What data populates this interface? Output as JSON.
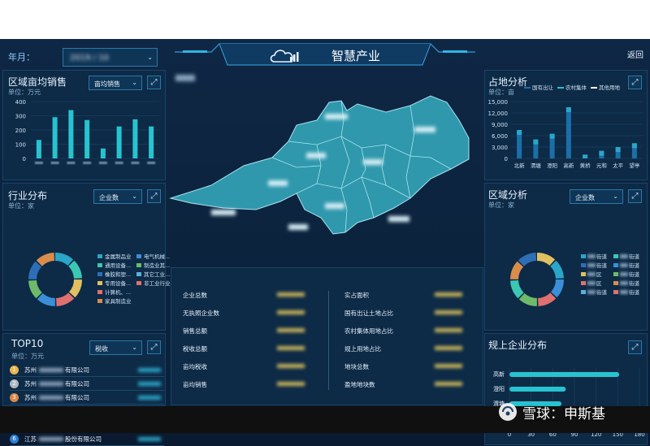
{
  "header": {
    "year_label": "年月：",
    "date_value": "2019 / 10",
    "title": "智慧产业",
    "back_label": "返回"
  },
  "sales": {
    "title": "区域亩均销售",
    "unit": "单位：万元",
    "select": "亩均销售",
    "chart_data": {
      "type": "bar",
      "yticks": [
        "400",
        "300",
        "200",
        "100",
        "0"
      ],
      "ylim": [
        0,
        400
      ],
      "values": [
        130,
        290,
        340,
        270,
        70,
        225,
        275,
        225
      ]
    }
  },
  "industry": {
    "title": "行业分布",
    "unit": "单位：家",
    "select": "企业数",
    "legend": [
      "金属制品业",
      "通用设备...",
      "橡胶和塑...",
      "专用设备...",
      "计算机、...",
      "家具制造业",
      "电气机械...",
      "制造业其...",
      "其它工业...",
      "非工业行业"
    ]
  },
  "top10": {
    "title": "TOP10",
    "unit": "单位：万元",
    "select": "税收",
    "rows": [
      {
        "rank": "1",
        "name": "苏州",
        "suffix": "有限公司"
      },
      {
        "rank": "2",
        "name": "苏州",
        "suffix": "有限公司"
      },
      {
        "rank": "3",
        "name": "苏州",
        "suffix": "有限公司"
      },
      {
        "rank": "4",
        "name": "苏州",
        "suffix": "科技有限公司"
      },
      {
        "rank": "5",
        "name": "苏州",
        "suffix": "科技股份有限公司"
      },
      {
        "rank": "6",
        "name": "江苏",
        "suffix": "股份有限公司"
      }
    ]
  },
  "stats": {
    "left": [
      "企业总数",
      "无执照企业数",
      "销售总额",
      "税收总额",
      "亩均税收",
      "亩均销售"
    ],
    "right": [
      "实占面积",
      "国有出让土地占比",
      "农村集体用地占比",
      "规上用地占比",
      "地块总数",
      "盈地地块数"
    ]
  },
  "land": {
    "title": "占地分析",
    "unit": "单位：亩",
    "legend": [
      "国有出让",
      "农村集体",
      "其他用地"
    ],
    "chart_data": {
      "type": "bar",
      "categories": [
        "北新",
        "渭塘",
        "澄阳",
        "高新",
        "黄桥",
        "元和",
        "太平",
        "望亭"
      ],
      "yticks": [
        "15,000",
        "12,000",
        "9,000",
        "6,000",
        "3,000",
        "0"
      ],
      "ylim": [
        0,
        15000
      ],
      "series": [
        {
          "name": "国有出让",
          "values": [
            7500,
            5000,
            6500,
            13500,
            1000,
            2000,
            3000,
            4000
          ]
        }
      ]
    }
  },
  "region": {
    "title": "区域分析",
    "unit": "单位：家",
    "select": "企业数",
    "legend": [
      "街道",
      "街道",
      "街道",
      "街道",
      "区",
      "街道",
      "区",
      "街道",
      "街道",
      "街道"
    ]
  },
  "scale": {
    "title": "规上企业分布",
    "chart_data": {
      "type": "bar",
      "categories": [
        "高新",
        "澄阳",
        "渭塘",
        "北桥"
      ],
      "values": [
        152,
        78,
        72,
        90
      ],
      "xticks": [
        "0",
        "30",
        "60",
        "90",
        "120",
        "150",
        "180"
      ],
      "xlim": [
        0,
        180
      ]
    }
  },
  "watermark": "雪球：申斯基",
  "colors": {
    "accent": "#27c3d0",
    "bar_dark": "#1b6fa8",
    "bar_light": "#2aa6c8",
    "gold": "#f0c040"
  }
}
